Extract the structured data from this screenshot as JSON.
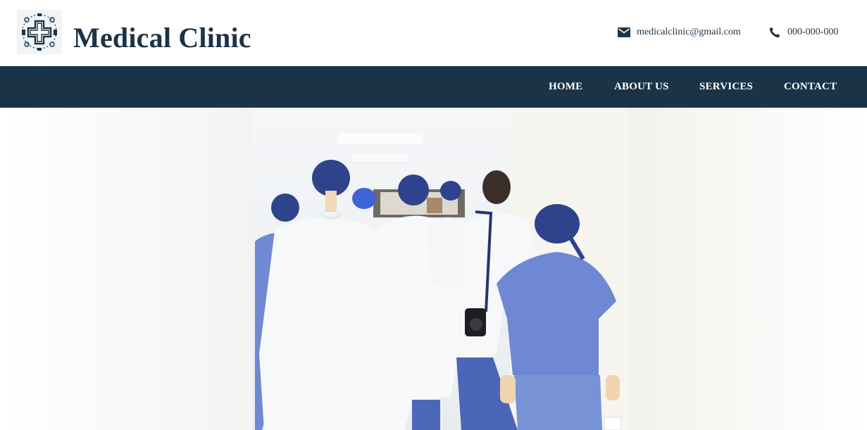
{
  "header": {
    "brand": "Medical Clinic",
    "logo_icon": "medical-cross-logo-icon",
    "email": "medicalclinic@gmail.com",
    "email_icon": "envelope-icon",
    "phone": "000-000-000",
    "phone_icon": "phone-icon"
  },
  "nav": {
    "items": [
      {
        "label": "HOME"
      },
      {
        "label": "ABOUT US"
      },
      {
        "label": "SERVICES"
      },
      {
        "label": "CONTACT"
      }
    ]
  },
  "hero": {
    "image": "hero-medical-staff-photo"
  },
  "colors": {
    "primary": "#1a3346",
    "text": "#1b3346",
    "scrub_blue": "#6a86d6",
    "cap_blue": "#2d3f8a",
    "coat_white": "#f7f8fa"
  }
}
